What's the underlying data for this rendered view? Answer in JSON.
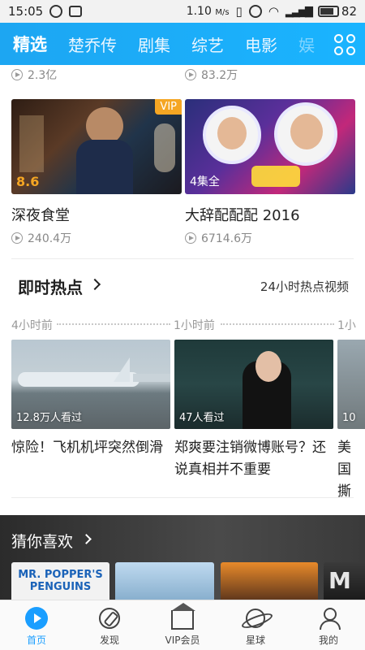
{
  "status_bar": {
    "time": "15:05",
    "network_speed": "1.10",
    "network_unit": "M/s",
    "battery": "82",
    "battery_fraction": 0.82
  },
  "top_nav": {
    "tabs": [
      {
        "label": "精选",
        "active": true
      },
      {
        "label": "楚乔传",
        "active": false
      },
      {
        "label": "剧集",
        "active": false
      },
      {
        "label": "综艺",
        "active": false
      },
      {
        "label": "电影",
        "active": false
      },
      {
        "label": "娱",
        "active": false
      }
    ]
  },
  "prev_row": {
    "left_count": "2.3亿",
    "right_count": "83.2万"
  },
  "cards": [
    {
      "title": "深夜食堂",
      "count": "240.4万",
      "badge": "VIP",
      "score": "8.6"
    },
    {
      "title": "大辞配配配 2016",
      "count": "6714.6万",
      "episodes": "4集全"
    }
  ],
  "hot": {
    "title": "即时热点",
    "link": "24小时热点视频",
    "items": [
      {
        "time": "4小时前",
        "views": "12.8万人看过",
        "title": "惊险！飞机机坪突然倒滑"
      },
      {
        "time": "1小时前",
        "views": "47人看过",
        "title": "郑爽要注销微博账号？还说真相并不重要"
      },
      {
        "time": "1小",
        "views": "10",
        "title": "美国撕"
      }
    ]
  },
  "guess": {
    "title": "猜你喜欢",
    "posters": [
      {
        "text": "MR. POPPER'S PENGUINS"
      },
      {
        "text": ""
      },
      {
        "text": ""
      },
      {
        "text": "M"
      }
    ]
  },
  "bottom_nav": {
    "items": [
      {
        "label": "首页",
        "active": true
      },
      {
        "label": "发现",
        "active": false
      },
      {
        "label": "VIP会员",
        "active": false
      },
      {
        "label": "星球",
        "active": false
      },
      {
        "label": "我的",
        "active": false
      }
    ]
  },
  "colors": {
    "accent": "#1a9eff",
    "vip": "#f5a623"
  }
}
